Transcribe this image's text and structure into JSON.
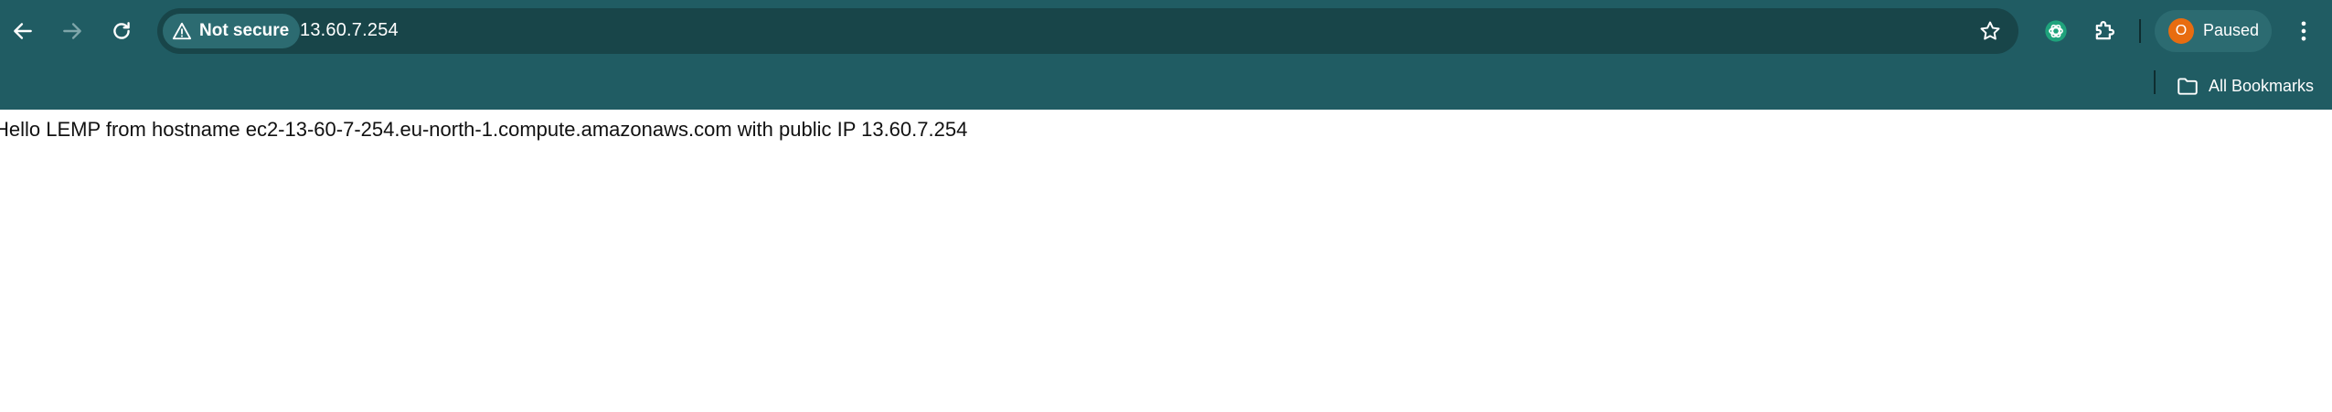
{
  "browser": {
    "colors": {
      "chrome_bg": "#205c63",
      "omnibox_bg": "#184549",
      "chip_bg": "#2c6b71",
      "avatar_bg": "#e86c10",
      "text": "#ffffff"
    },
    "toolbar": {
      "back_icon": "arrow-left",
      "forward_icon": "arrow-right",
      "reload_icon": "reload",
      "security_icon": "warning-triangle",
      "security_label": "Not secure",
      "url": "13.60.7.254",
      "bookmark_icon": "star-outline",
      "extension1_icon": "chatgpt-logo",
      "extension2_icon": "puzzle",
      "profile_initial": "O",
      "profile_status": "Paused",
      "menu_icon": "kebab-menu"
    },
    "bookmarks_bar": {
      "folder_icon": "folder",
      "folder_label": "All Bookmarks"
    }
  },
  "page": {
    "text": "Hello LEMP from hostname ec2-13-60-7-254.eu-north-1.compute.amazonaws.com with public IP 13.60.7.254"
  }
}
